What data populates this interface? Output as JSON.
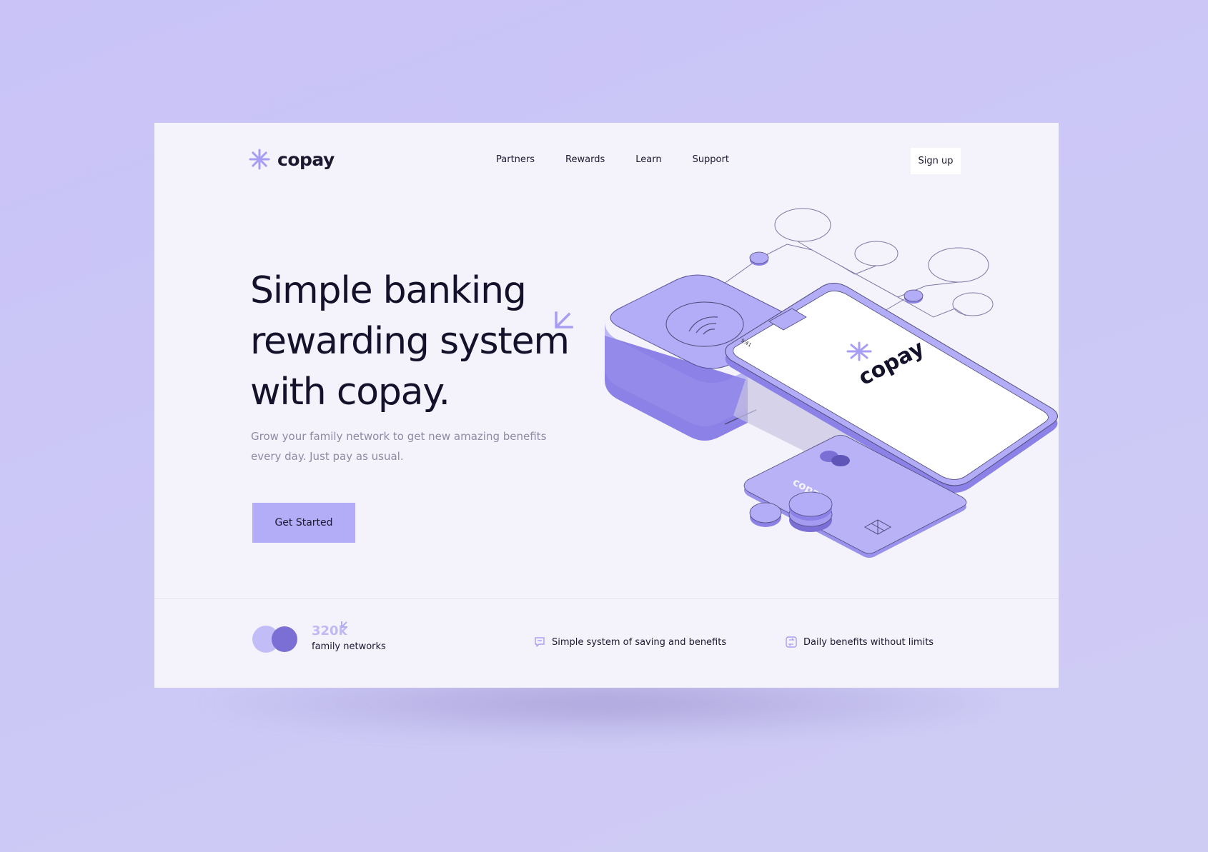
{
  "brand": {
    "name": "copay",
    "icon": "asterisk-icon",
    "accent": "#b3acf6",
    "dark_accent": "#7b6fd6"
  },
  "nav": {
    "items": [
      "Partners",
      "Rewards",
      "Learn",
      "Support"
    ]
  },
  "header": {
    "signup_label": "Sign up"
  },
  "hero": {
    "title_lines": [
      "Simple banking",
      "rewarding system",
      "with copay."
    ],
    "subtitle": "Grow your family network to get new amazing benefits every day. Just pay as usual.",
    "cta_label": "Get Started"
  },
  "illustration": {
    "phone_brand": "copay",
    "phone_time": "9:41",
    "card_brand": "copay"
  },
  "stats": {
    "value": "320k",
    "label": "family networks"
  },
  "features": [
    {
      "icon": "chat-bubble-icon",
      "label": "Simple system of saving and benefits"
    },
    {
      "icon": "transfer-icon",
      "label": "Daily benefits without limits"
    }
  ]
}
